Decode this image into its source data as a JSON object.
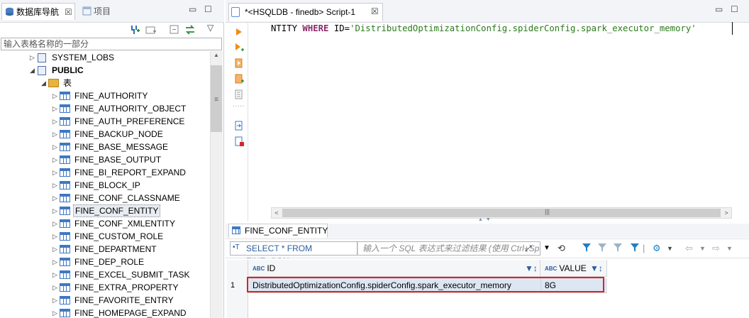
{
  "navigator": {
    "tab_label": "数据库导航",
    "close_glyph": "☒",
    "project_tab_label": "项目",
    "filter_placeholder": "输入表格名称的一部分",
    "tree": [
      {
        "label": "SYSTEM_LOBS",
        "kind": "schema",
        "expanded": false
      },
      {
        "label": "PUBLIC",
        "kind": "schema",
        "expanded": true
      },
      {
        "label": "表",
        "kind": "folder",
        "expanded": true
      },
      {
        "label": "FINE_AUTHORITY",
        "kind": "table"
      },
      {
        "label": "FINE_AUTHORITY_OBJECT",
        "kind": "table"
      },
      {
        "label": "FINE_AUTH_PREFERENCE",
        "kind": "table"
      },
      {
        "label": "FINE_BACKUP_NODE",
        "kind": "table"
      },
      {
        "label": "FINE_BASE_MESSAGE",
        "kind": "table"
      },
      {
        "label": "FINE_BASE_OUTPUT",
        "kind": "table"
      },
      {
        "label": "FINE_BI_REPORT_EXPAND",
        "kind": "table"
      },
      {
        "label": "FINE_BLOCK_IP",
        "kind": "table"
      },
      {
        "label": "FINE_CONF_CLASSNAME",
        "kind": "table"
      },
      {
        "label": "FINE_CONF_ENTITY",
        "kind": "table",
        "selected": true
      },
      {
        "label": "FINE_CONF_XMLENTITY",
        "kind": "table"
      },
      {
        "label": "FINE_CUSTOM_ROLE",
        "kind": "table"
      },
      {
        "label": "FINE_DEPARTMENT",
        "kind": "table"
      },
      {
        "label": "FINE_DEP_ROLE",
        "kind": "table"
      },
      {
        "label": "FINE_EXCEL_SUBMIT_TASK",
        "kind": "table"
      },
      {
        "label": "FINE_EXTRA_PROPERTY",
        "kind": "table"
      },
      {
        "label": "FINE_FAVORITE_ENTRY",
        "kind": "table"
      },
      {
        "label": "FINE_HOMEPAGE_EXPAND",
        "kind": "table"
      }
    ]
  },
  "editor": {
    "tab_label": "*<HSQLDB - finedb> Script-1",
    "close_glyph": "☒",
    "code": {
      "prefix": "NTITY ",
      "kw_where": "WHERE",
      "mid": " ID=",
      "literal": "'DistributedOptimizationConfig.spiderConfig.spark_executor_memory'"
    }
  },
  "results": {
    "tab_label": "FINE_CONF_ENTITY",
    "sql_label": "SELECT * FROM FINE_CON",
    "filter_placeholder": "输入一个 SQL 表达式来过滤结果 (使用 Ctrl+Space)",
    "columns": [
      {
        "name": "ID",
        "type_badge": "ABC"
      },
      {
        "name": "VALUE",
        "type_badge": "ABC"
      }
    ],
    "rows": [
      {
        "num": "1",
        "id": "DistributedOptimizationConfig.spiderConfig.spark_executor_memory",
        "value": "8G"
      }
    ]
  },
  "colors": {
    "highlight_border": "#e02020",
    "accent_blue": "#3e78c2",
    "keyword": "#8a2a6a",
    "string_literal": "#2a7a1a"
  },
  "icons": [
    "database-navigator-icon",
    "project-icon",
    "minimize-icon",
    "maximize-icon",
    "connect-icon",
    "new-folder-icon",
    "collapse-all-icon",
    "link-editor-icon",
    "view-menu-icon",
    "execute-statement-icon",
    "execute-script-icon",
    "explain-plan-icon",
    "load-script-icon",
    "save-script-icon",
    "new-script-icon",
    "delete-script-icon",
    "filter-icon",
    "clear-filter-icon",
    "history-icon",
    "refresh-icon",
    "back-icon",
    "forward-icon"
  ]
}
